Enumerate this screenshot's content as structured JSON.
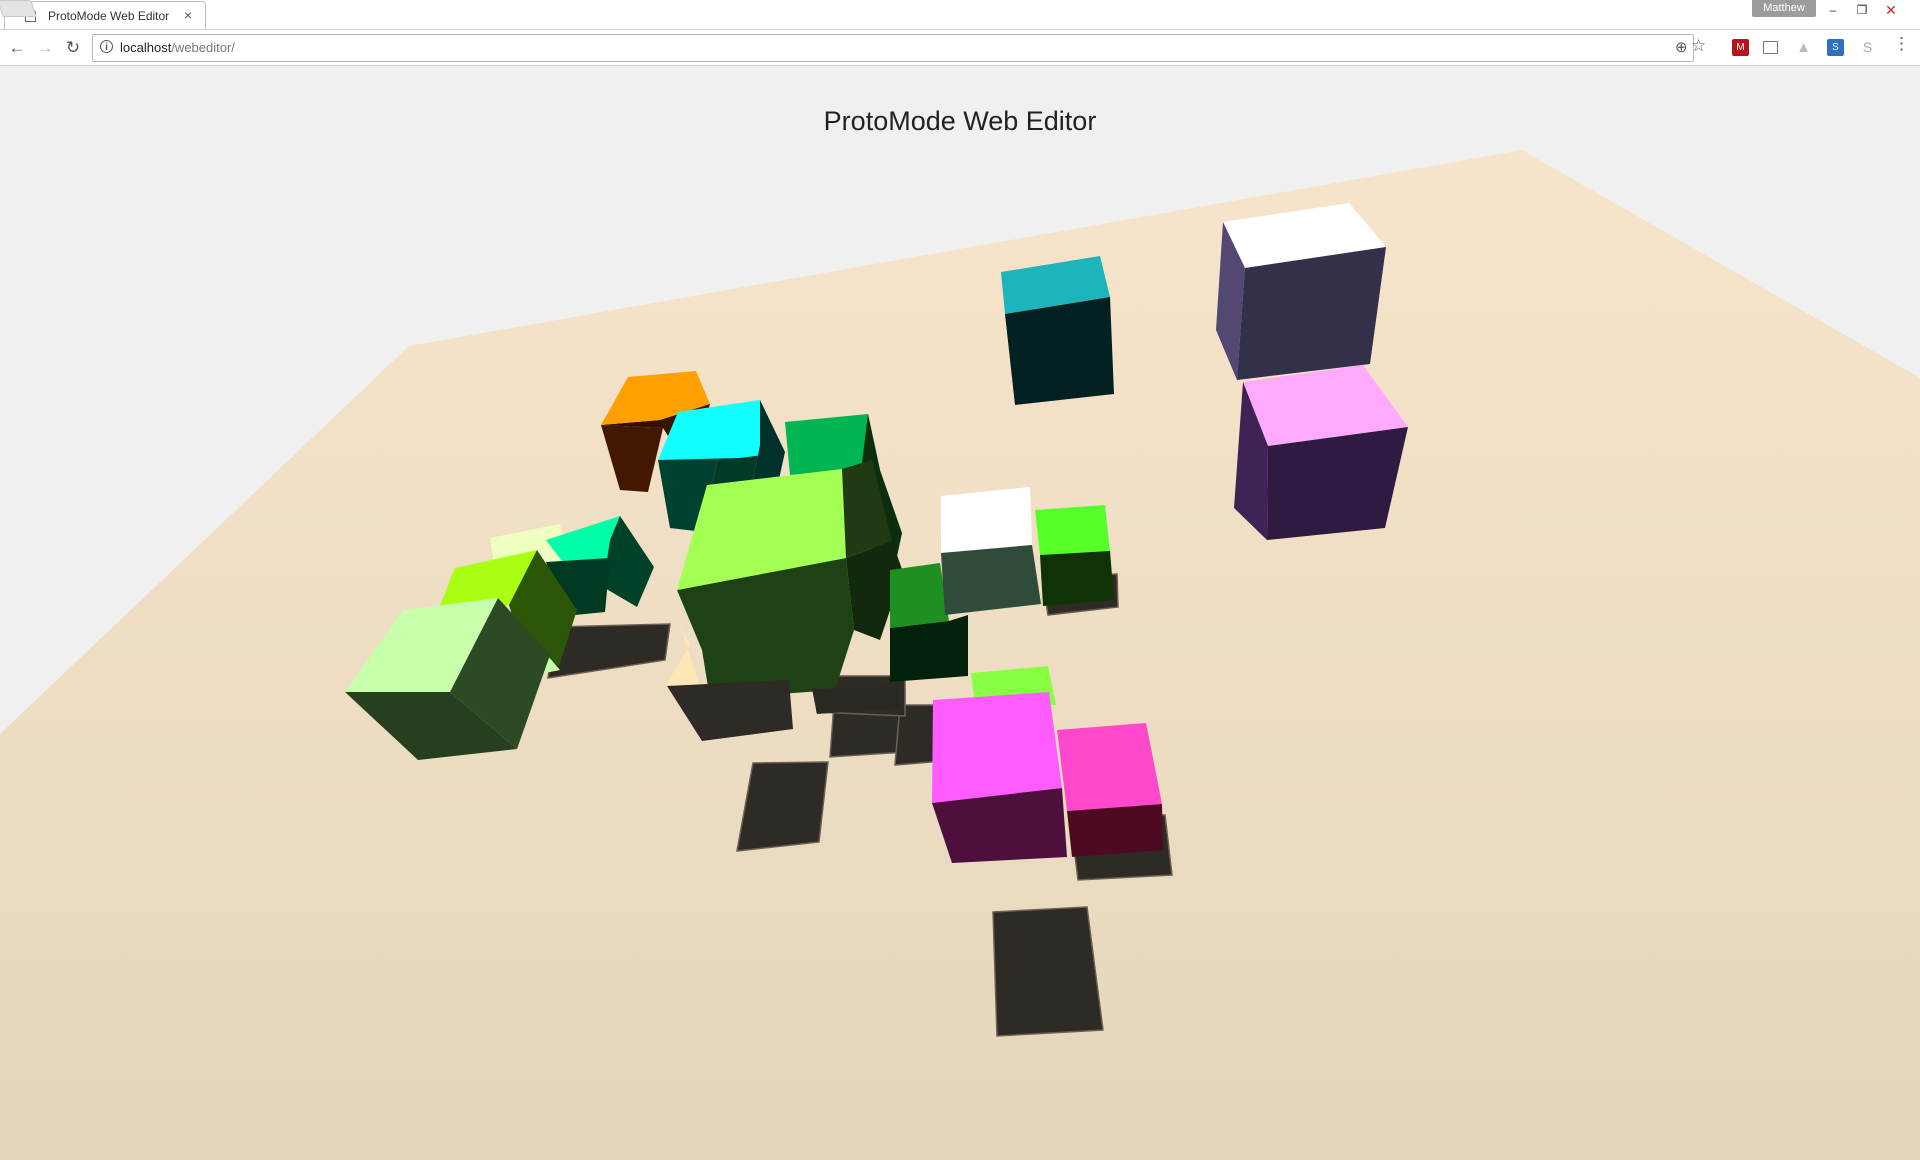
{
  "browser": {
    "tab_title": "ProtoMode Web Editor",
    "tab_close": "×",
    "profile_name": "Matthew",
    "window_controls": {
      "minimize": "–",
      "restore": "❐",
      "close": "✕"
    },
    "nav": {
      "back": "←",
      "forward": "→",
      "reload": "↻"
    },
    "url_host": "localhost",
    "url_path": "/webeditor/",
    "info_symbol": "i",
    "zoom_symbol": "⊕",
    "star_symbol": "☆",
    "menu_symbol": "⋮",
    "extensions": [
      {
        "name": "red-extension-icon",
        "glyph": "M"
      },
      {
        "name": "cast-icon",
        "glyph": ""
      },
      {
        "name": "drive-icon",
        "glyph": "▲"
      },
      {
        "name": "news-extension-icon",
        "glyph": "S"
      },
      {
        "name": "skype-icon",
        "glyph": "S"
      }
    ]
  },
  "page": {
    "title": "ProtoMode Web Editor"
  },
  "scene": {
    "ground_color": "#f1e1c7",
    "shadow_color": "#2e2a26",
    "cube_colors": [
      "#ffa000",
      "#12ffff",
      "#00b552",
      "#a4ff55",
      "#ffffff",
      "#55ff2a",
      "#1db5bc",
      "#ffffff",
      "#ffaaff",
      "#eeffc0",
      "#00ffa8",
      "#a8ff12",
      "#c8ffaa",
      "#ffe6b6",
      "#1d9021",
      "#88ff44",
      "#ff5cff",
      "#ff48cc"
    ]
  }
}
